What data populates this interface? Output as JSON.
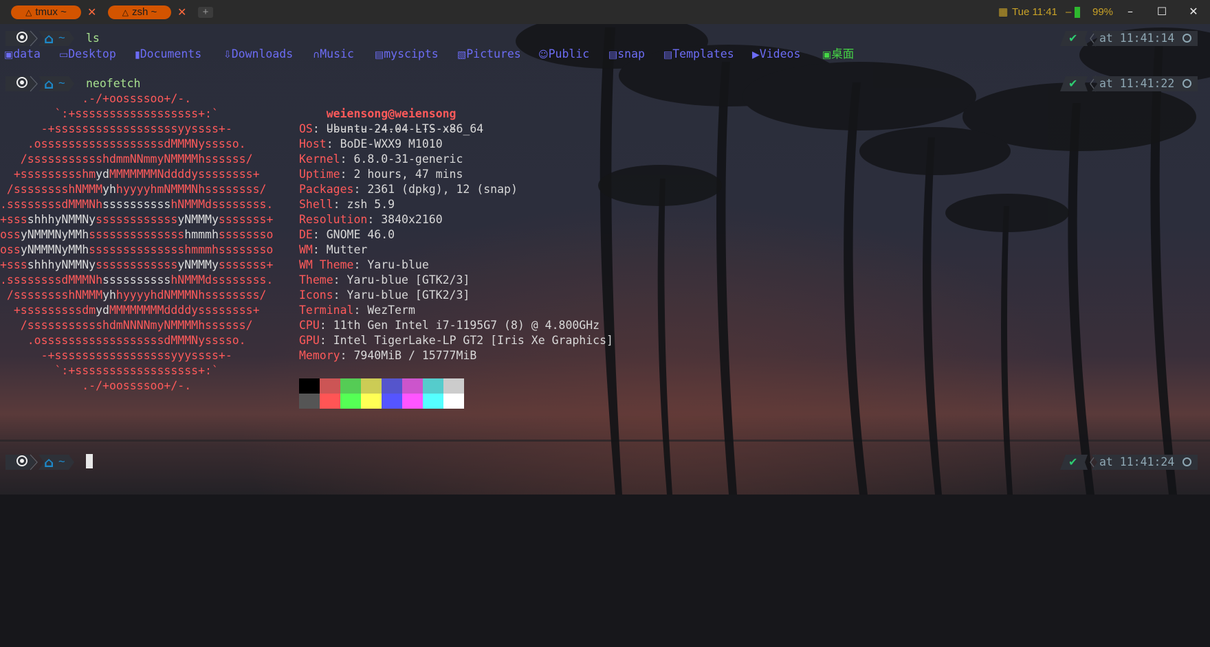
{
  "tabs": [
    {
      "label": "tmux ~",
      "active": false
    },
    {
      "label": "zsh ~",
      "active": true
    }
  ],
  "new_tab_label": "+",
  "tab_close_glyph": "✕",
  "status": {
    "datetime": "Tue 11:41",
    "separator": "–",
    "battery": "99%"
  },
  "window_controls": {
    "minimize": "–",
    "maximize": "☐",
    "close": "✕"
  },
  "prompt": {
    "home_symbol": "~"
  },
  "commands": [
    {
      "cmd": "ls",
      "time": "at 11:41:14"
    },
    {
      "cmd": "neofetch",
      "time": "at 11:41:22"
    },
    {
      "cmd": "",
      "time": "at 11:41:24"
    }
  ],
  "ls_output": [
    {
      "icon": "folder-icon",
      "name": "data"
    },
    {
      "icon": "monitor-icon",
      "name": "Desktop"
    },
    {
      "icon": "book-icon",
      "name": "Documents"
    },
    {
      "icon": "download-icon",
      "name": "Downloads"
    },
    {
      "icon": "headphones-icon",
      "name": "Music"
    },
    {
      "icon": "folder-open-icon",
      "name": "myscipts"
    },
    {
      "icon": "image-icon",
      "name": "Pictures"
    },
    {
      "icon": "user-icon",
      "name": "Public"
    },
    {
      "icon": "folder-open-icon",
      "name": "snap"
    },
    {
      "icon": "folder-open-icon",
      "name": "Templates"
    },
    {
      "icon": "video-icon",
      "name": "Videos"
    },
    {
      "icon": "terminal-icon",
      "name": "桌面"
    }
  ],
  "neofetch": {
    "logo": [
      [
        [
          "r",
          "            .-/+oossssoo+/-."
        ]
      ],
      [
        [
          "r",
          "        `:+ssssssssssssssssss+:`"
        ]
      ],
      [
        [
          "r",
          "      -+ssssssssssssssssssyyssss+-"
        ]
      ],
      [
        [
          "r",
          "    .ossssssssssssssssssdMMMNysssso."
        ]
      ],
      [
        [
          "r",
          "   /ssssssssssshdmmNNmmyNMMMMhssssss/"
        ]
      ],
      [
        [
          "r",
          "  +ssssssssshm"
        ],
        [
          "w",
          "yd"
        ],
        [
          "r",
          "MMMMMMMNddddyssssssss+"
        ]
      ],
      [
        [
          "r",
          " /sssssssshNMMM"
        ],
        [
          "w",
          "yh"
        ],
        [
          "r",
          "hyyyyhmNMMMNhssssssss/"
        ]
      ],
      [
        [
          "r",
          ".ssssssssdMMMNh"
        ],
        [
          "w",
          "ssssssssss"
        ],
        [
          "r",
          "hNMMMdssssssss."
        ]
      ],
      [
        [
          "r",
          "+sss"
        ],
        [
          "w",
          "shhhyNMMNy"
        ],
        [
          "r",
          "ssssssssssss"
        ],
        [
          "w",
          "yNMMMy"
        ],
        [
          "r",
          "sssssss+"
        ]
      ],
      [
        [
          "r",
          "oss"
        ],
        [
          "w",
          "yNMMMNyMMh"
        ],
        [
          "r",
          "ssssssssssssss"
        ],
        [
          "w",
          "hmmmh"
        ],
        [
          "r",
          "ssssssso"
        ]
      ],
      [
        [
          "r",
          "oss"
        ],
        [
          "w",
          "yNMMMNyMMh"
        ],
        [
          "r",
          "sssssssssssssshmmmhssssssso"
        ]
      ],
      [
        [
          "r",
          "+sss"
        ],
        [
          "w",
          "shhhyNMMNy"
        ],
        [
          "r",
          "ssssssssssss"
        ],
        [
          "w",
          "yNMMMy"
        ],
        [
          "r",
          "sssssss+"
        ]
      ],
      [
        [
          "r",
          ".ssssssssdMMMNh"
        ],
        [
          "w",
          "ssssssssss"
        ],
        [
          "r",
          "hNMMMdssssssss."
        ]
      ],
      [
        [
          "r",
          " /sssssssshNMMM"
        ],
        [
          "w",
          "yh"
        ],
        [
          "r",
          "hyyyyhdNMMMNhssssssss/"
        ]
      ],
      [
        [
          "r",
          "  +sssssssssdm"
        ],
        [
          "w",
          "yd"
        ],
        [
          "r",
          "MMMMMMMMddddyssssssss+"
        ]
      ],
      [
        [
          "r",
          "   /ssssssssssshdmNNNNmyNMMMMhssssss/"
        ]
      ],
      [
        [
          "r",
          "    .ossssssssssssssssssdMMMNysssso."
        ]
      ],
      [
        [
          "r",
          "      -+sssssssssssssssssyyyssss+-"
        ]
      ],
      [
        [
          "r",
          "        `:+ssssssssssssssssss+:`"
        ]
      ],
      [
        [
          "r",
          "            .-/+oossssoo+/-."
        ]
      ]
    ],
    "title": "weiensong@weiensong",
    "underline": "-------------------",
    "info": [
      {
        "key": "OS",
        "value": "Ubuntu 24.04 LTS x86_64"
      },
      {
        "key": "Host",
        "value": "BoDE-WXX9 M1010"
      },
      {
        "key": "Kernel",
        "value": "6.8.0-31-generic"
      },
      {
        "key": "Uptime",
        "value": "2 hours, 47 mins"
      },
      {
        "key": "Packages",
        "value": "2361 (dpkg), 12 (snap)"
      },
      {
        "key": "Shell",
        "value": "zsh 5.9"
      },
      {
        "key": "Resolution",
        "value": "3840x2160"
      },
      {
        "key": "DE",
        "value": "GNOME 46.0"
      },
      {
        "key": "WM",
        "value": "Mutter"
      },
      {
        "key": "WM Theme",
        "value": "Yaru-blue"
      },
      {
        "key": "Theme",
        "value": "Yaru-blue [GTK2/3]"
      },
      {
        "key": "Icons",
        "value": "Yaru-blue [GTK2/3]"
      },
      {
        "key": "Terminal",
        "value": "WezTerm"
      },
      {
        "key": "CPU",
        "value": "11th Gen Intel i7-1195G7 (8) @ 4.800GHz"
      },
      {
        "key": "GPU",
        "value": "Intel TigerLake-LP GT2 [Iris Xe Graphics]"
      },
      {
        "key": "Memory",
        "value": "7940MiB / 15777MiB"
      }
    ],
    "palette_top": [
      "#000000",
      "#cc5555",
      "#55cc55",
      "#cccc55",
      "#5555cc",
      "#cc55cc",
      "#55cccc",
      "#cccccc"
    ],
    "palette_bottom": [
      "#555555",
      "#ff5555",
      "#55ff55",
      "#ffff55",
      "#5555ff",
      "#ff55ff",
      "#55ffff",
      "#ffffff"
    ]
  },
  "colors": {
    "accent_tab": "#d35400",
    "prompt_bg": "#2e3138",
    "home_blue": "#1e88c8",
    "ls_blue": "#6c6cf4",
    "ls_green": "#45d645",
    "neofetch_red": "#ff5a5a"
  }
}
